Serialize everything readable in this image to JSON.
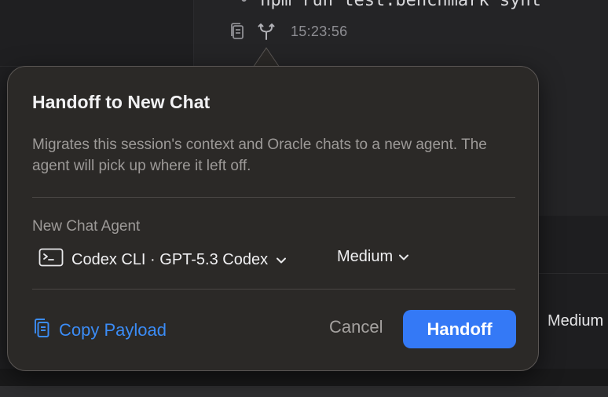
{
  "background": {
    "code_line": "npm run test:benchmark synt",
    "code_bullet": "•",
    "timestamp": "15:23:56",
    "right_effort_label": "Medium"
  },
  "popover": {
    "title": "Handoff to New Chat",
    "description": "Migrates this session's context and Oracle chats to a new agent. The agent will pick up where it left off.",
    "section_label": "New Chat Agent",
    "agent": {
      "icon": "terminal-icon",
      "value": "Codex CLI · GPT-5.3 Codex"
    },
    "effort": {
      "value": "Medium"
    },
    "copy_payload_label": "Copy Payload",
    "cancel_label": "Cancel",
    "handoff_label": "Handoff"
  },
  "colors": {
    "accent": "#3479f6",
    "link": "#3b8cf6",
    "popover_bg": "#2b2927"
  }
}
